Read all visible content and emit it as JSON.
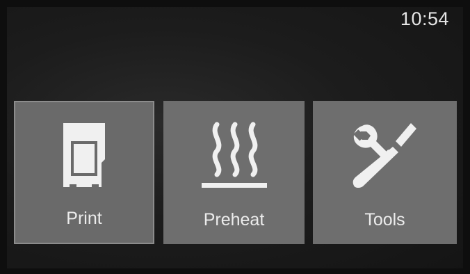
{
  "status_bar": {
    "time": "10:54"
  },
  "menu": {
    "tiles": [
      {
        "label": "Print",
        "icon": "sd-card-icon",
        "selected": true
      },
      {
        "label": "Preheat",
        "icon": "heat-waves-icon",
        "selected": false
      },
      {
        "label": "Tools",
        "icon": "wrench-screwdriver-icon",
        "selected": false
      }
    ]
  },
  "colors": {
    "tile_background": "#6e6e6e",
    "icon_foreground": "#f0f0f0",
    "screen_background": "#1c1c1c"
  }
}
